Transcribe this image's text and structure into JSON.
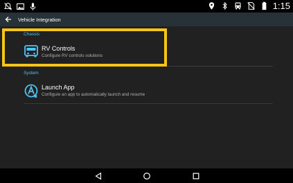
{
  "status_bar": {
    "left_icons": [
      "notification-muted-icon",
      "image-icon",
      "microphone-icon"
    ],
    "right_icons": [
      "location-icon",
      "bluetooth-icon",
      "bus-icon",
      "no-sim-icon",
      "battery-icon"
    ],
    "time": "1:15"
  },
  "app_bar": {
    "back_icon": "arrow-back-icon",
    "title": "Vehicle Integration"
  },
  "sections": [
    {
      "header": "Chassis",
      "items": [
        {
          "icon": "rv-icon",
          "title": "RV Controls",
          "summary": "Configure RV controls solutions",
          "highlighted": true
        }
      ]
    },
    {
      "header": "System",
      "items": [
        {
          "icon": "launch-app-icon",
          "title": "Launch App",
          "summary": "Configure an app to automatically launch and resume"
        }
      ]
    }
  ],
  "nav_bar": {
    "buttons": [
      "back-triangle-icon",
      "home-circle-icon",
      "recents-square-icon"
    ]
  },
  "colors": {
    "accent": "#4fc3f7",
    "app_bar": "#263238",
    "highlight": "#f5c518",
    "background": "#212121"
  }
}
